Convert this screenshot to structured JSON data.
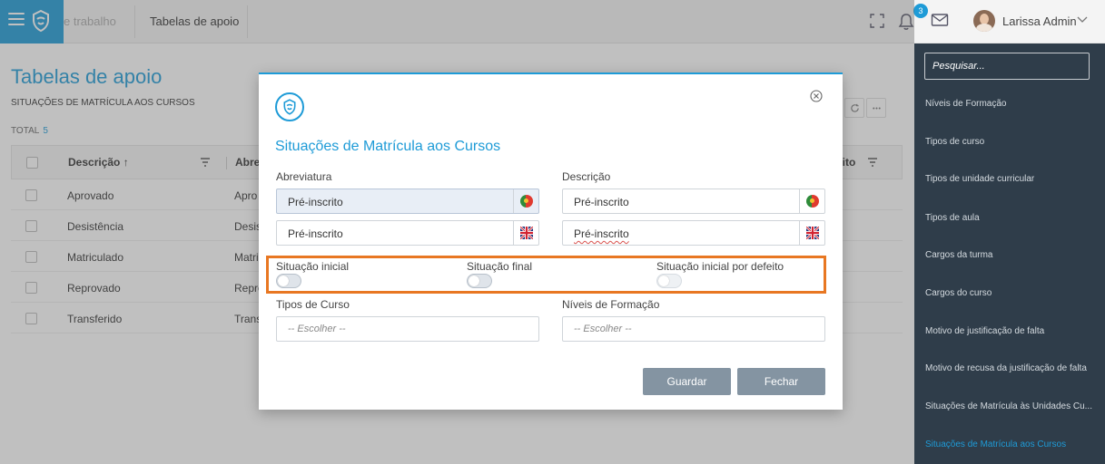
{
  "topbar": {
    "breadcrumb_partial": "e trabalho",
    "breadcrumb_current": "Tabelas de apoio",
    "notification_count": "3",
    "user_name": "Larissa Admin"
  },
  "page": {
    "title": "Tabelas de apoio",
    "subtitle": "SITUAÇÕES DE MATRÍCULA AOS CURSOS",
    "total_label": "TOTAL",
    "total_count": "5"
  },
  "grid": {
    "headers": {
      "descricao": "Descrição ↑",
      "abreviatura": "Abre",
      "right": "eito"
    },
    "rows": [
      {
        "descricao": "Aprovado",
        "abreviatura": "Apro"
      },
      {
        "descricao": "Desistência",
        "abreviatura": "Desis"
      },
      {
        "descricao": "Matriculado",
        "abreviatura": "Matri"
      },
      {
        "descricao": "Reprovado",
        "abreviatura": "Repro"
      },
      {
        "descricao": "Transferido",
        "abreviatura": "Trans"
      }
    ]
  },
  "sidebar": {
    "search_placeholder": "Pesquisar...",
    "items": [
      {
        "label": "Níveis de Formação"
      },
      {
        "label": "Tipos de curso"
      },
      {
        "label": "Tipos de unidade curricular"
      },
      {
        "label": "Tipos de aula"
      },
      {
        "label": "Cargos da turma"
      },
      {
        "label": "Cargos do curso"
      },
      {
        "label": "Motivo de justificação de falta"
      },
      {
        "label": "Motivo de recusa da justificação de falta"
      },
      {
        "label": "Situações de Matrícula às Unidades Cu..."
      },
      {
        "label": "Situações de Matrícula aos Cursos"
      }
    ]
  },
  "modal": {
    "title": "Situações de Matrícula aos Cursos",
    "abreviatura_label": "Abreviatura",
    "descricao_label": "Descrição",
    "abreviatura_pt": "Pré-inscrito",
    "abreviatura_en": "Pré-inscrito",
    "descricao_pt": "Pré-inscrito",
    "descricao_en": "Pré-inscrito",
    "toggle_inicial_label": "Situação inicial",
    "toggle_final_label": "Situação final",
    "toggle_defeito_label": "Situação inicial por defeito",
    "tipos_curso_label": "Tipos de Curso",
    "niveis_formacao_label": "Níveis de Formação",
    "tipos_curso_value": "-- Escolher --",
    "niveis_formacao_value": "-- Escolher --",
    "save_label": "Guardar",
    "close_label": "Fechar"
  },
  "colors": {
    "accent": "#1e9bd7",
    "highlight_frame": "#e87722",
    "sidebar_bg": "#2f3d4a",
    "button_bg": "#8494a2"
  }
}
